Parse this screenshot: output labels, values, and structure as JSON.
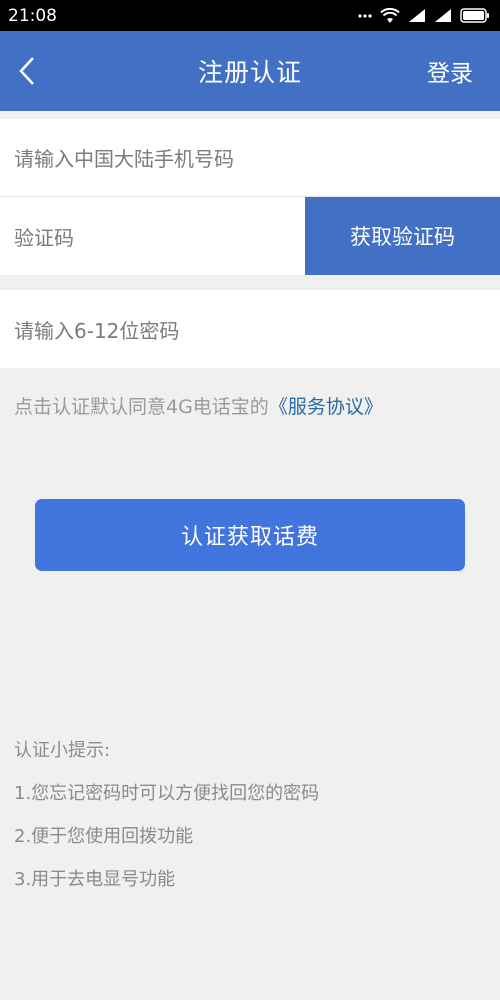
{
  "status": {
    "time": "21:08"
  },
  "nav": {
    "title": "注册认证",
    "login": "登录"
  },
  "form": {
    "phone_placeholder": "请输入中国大陆手机号码",
    "code_placeholder": "验证码",
    "get_code": "获取验证码",
    "password_placeholder": "请输入6-12位密码"
  },
  "agreement": {
    "text": "点击认证默认同意4G电话宝的",
    "link": "《服务协议》"
  },
  "submit": {
    "label": "认证获取话费"
  },
  "tips": {
    "title": "认证小提示:",
    "items": [
      "1.您忘记密码时可以方便找回您的密码",
      "2.便于您使用回拨功能",
      "3.用于去电显号功能"
    ]
  },
  "colors": {
    "primary": "#4170c4",
    "button": "#4274de",
    "link": "#2c6aa5"
  }
}
